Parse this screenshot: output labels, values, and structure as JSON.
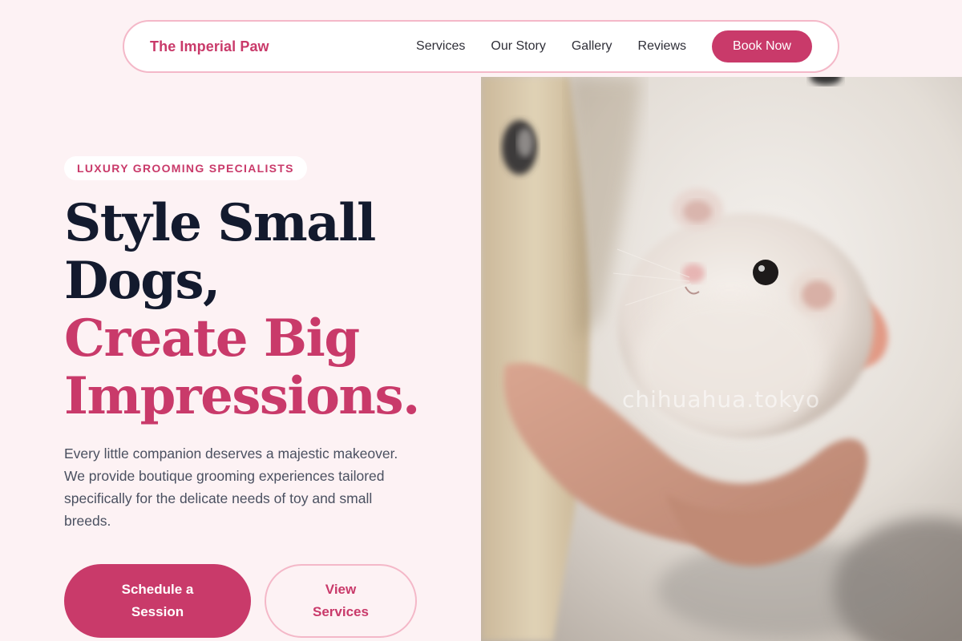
{
  "nav": {
    "brand": "The Imperial Paw",
    "links": [
      {
        "label": "Services"
      },
      {
        "label": "Our Story"
      },
      {
        "label": "Gallery"
      },
      {
        "label": "Reviews"
      }
    ],
    "cta": "Book Now"
  },
  "hero": {
    "badge": "LUXURY GROOMING SPECIALISTS",
    "headline_line1": "Style Small",
    "headline_line2": "Dogs,",
    "headline_line3": "Create Big",
    "headline_line4": "Impressions.",
    "description": "Every little companion deserves a majestic makeover. We provide boutique grooming experiences tailored specifically for the delicate needs of toy and small breeds.",
    "primary_button": "Schedule a Session",
    "secondary_button": "View Services",
    "image_watermark": "chihuahua.tokyo"
  },
  "colors": {
    "accent": "#c93a6a",
    "background": "#fdf2f4",
    "heading": "#131a2e",
    "body_text": "#4a5060",
    "border": "#f4b8c8"
  }
}
